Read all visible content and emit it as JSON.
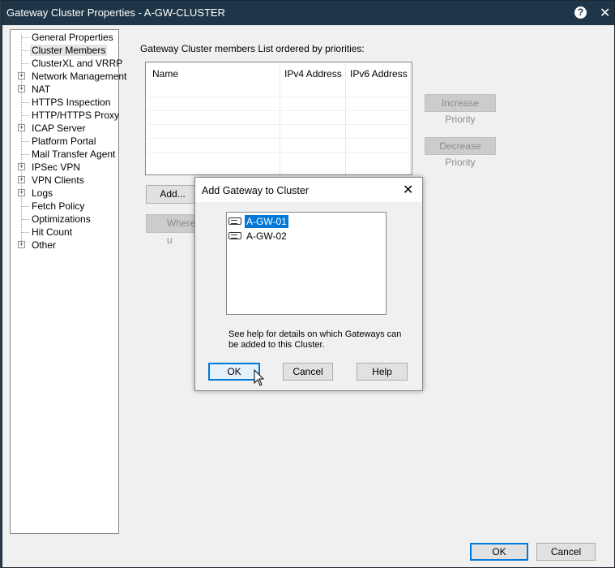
{
  "window": {
    "title": "Gateway Cluster Properties - A-GW-CLUSTER",
    "help_icon": "?",
    "close_icon": "✕"
  },
  "sidebar": {
    "items": [
      {
        "label": "General Properties",
        "expandable": false,
        "selected": false
      },
      {
        "label": "Cluster Members",
        "expandable": false,
        "selected": true
      },
      {
        "label": "ClusterXL and VRRP",
        "expandable": false,
        "selected": false
      },
      {
        "label": "Network Management",
        "expandable": true,
        "selected": false
      },
      {
        "label": "NAT",
        "expandable": true,
        "selected": false
      },
      {
        "label": "HTTPS Inspection",
        "expandable": false,
        "selected": false
      },
      {
        "label": "HTTP/HTTPS Proxy",
        "expandable": false,
        "selected": false
      },
      {
        "label": "ICAP Server",
        "expandable": true,
        "selected": false
      },
      {
        "label": "Platform Portal",
        "expandable": false,
        "selected": false
      },
      {
        "label": "Mail Transfer Agent",
        "expandable": false,
        "selected": false
      },
      {
        "label": "IPSec VPN",
        "expandable": true,
        "selected": false
      },
      {
        "label": "VPN Clients",
        "expandable": true,
        "selected": false
      },
      {
        "label": "Logs",
        "expandable": true,
        "selected": false
      },
      {
        "label": "Fetch Policy",
        "expandable": false,
        "selected": false
      },
      {
        "label": "Optimizations",
        "expandable": false,
        "selected": false
      },
      {
        "label": "Hit Count",
        "expandable": false,
        "selected": false
      },
      {
        "label": "Other",
        "expandable": true,
        "selected": false
      }
    ]
  },
  "members": {
    "caption": "Gateway Cluster members List ordered by priorities:",
    "columns": [
      "Name",
      "IPv4 Address",
      "IPv6 Address"
    ],
    "add_label": "Add...",
    "where_used_label": "Where u",
    "increase_label": "Increase Priority",
    "decrease_label": "Decrease Priority"
  },
  "dialog": {
    "title": "Add Gateway to Cluster",
    "close_icon": "✕",
    "gateways": [
      {
        "name": "A-GW-01",
        "selected": true
      },
      {
        "name": "A-GW-02",
        "selected": false
      }
    ],
    "note": "See help for details on which Gateways can be added to this Cluster.",
    "ok_label": "OK",
    "cancel_label": "Cancel",
    "help_label": "Help"
  },
  "footer": {
    "ok_label": "OK",
    "cancel_label": "Cancel"
  },
  "colors": {
    "titlebar": "#1e3647",
    "selection": "#0078d7",
    "focus_border": "#0078d7"
  }
}
